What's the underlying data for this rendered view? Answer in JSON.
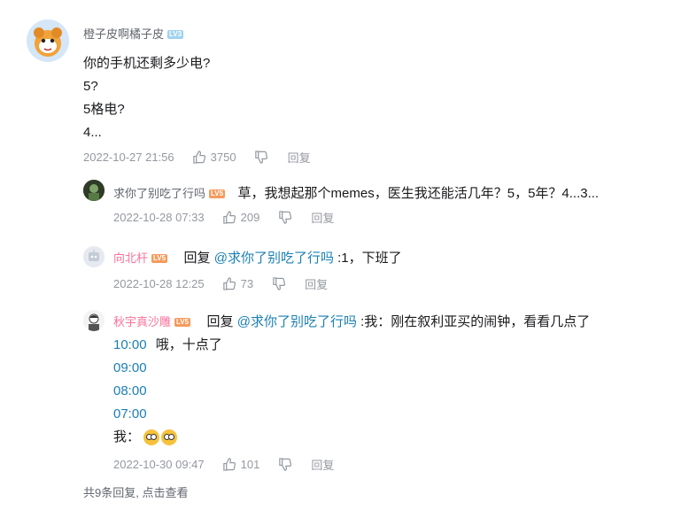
{
  "main_comment": {
    "user": "橙子皮啊橘子皮",
    "level": "LV3",
    "lines": [
      "你的手机还剩多少电?",
      "5?",
      "5格电?",
      "4..."
    ],
    "date": "2022-10-27 21:56",
    "likes": "3750",
    "reply_label": "回复"
  },
  "replies": [
    {
      "user": "求你了别吃了行吗",
      "level": "LV5",
      "text": "草，我想起那个memes，医生我还能活几年？5，5年？4...3...",
      "date": "2022-10-28 07:33",
      "likes": "209",
      "reply_label": "回复"
    },
    {
      "user": "向北杆",
      "level": "LV5",
      "prefix": "回复 ",
      "mention": "@求你了别吃了行吗",
      "text": " :1，下班了",
      "date": "2022-10-28 12:25",
      "likes": "73",
      "reply_label": "回复"
    },
    {
      "user": "秋宇真沙雕",
      "level": "LV5",
      "prefix": "回复 ",
      "mention": "@求你了别吃了行吗",
      "text": " :我：刚在叙利亚买的闹钟，看看几点了",
      "line2_time": "10:00",
      "line2_text": "哦，十点了",
      "times": [
        "09:00",
        "08:00",
        "07:00"
      ],
      "last_text": "我：",
      "date": "2022-10-30 09:47",
      "likes": "101",
      "reply_label": "回复"
    }
  ],
  "footer": "共9条回复, 点击查看",
  "colors": {
    "link": "#1a7fb5",
    "meta": "#9499a0",
    "level3": "#9fd3ef",
    "level5": "#f59b5c"
  }
}
